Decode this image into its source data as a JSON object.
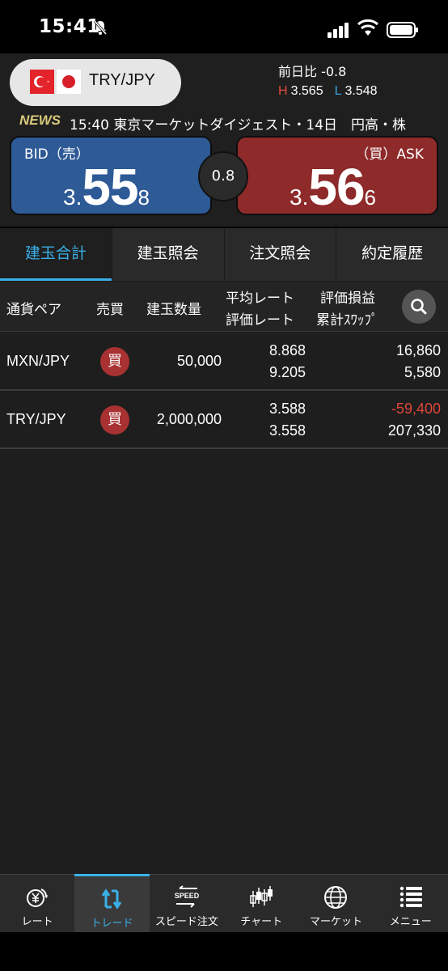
{
  "status": {
    "time": "15:41"
  },
  "header": {
    "pair": "TRY/JPY",
    "prev_diff": "前日比 -0.8",
    "high_label": "H",
    "high": "3.565",
    "low_label": "L",
    "low": "3.548",
    "news_badge": "NEWS",
    "news_text": "15:40 東京マーケットダイジェスト・14日　円高・株",
    "bid_label": "BID（売）",
    "bid": {
      "p1": "3.",
      "p2": "55",
      "p3": "8"
    },
    "ask_label": "（買）ASK",
    "ask": {
      "p1": "3.",
      "p2": "56",
      "p3": "6"
    },
    "spread": "0.8"
  },
  "tabs": [
    {
      "label": "建玉合計",
      "active": true
    },
    {
      "label": "建玉照会",
      "active": false
    },
    {
      "label": "注文照会",
      "active": false
    },
    {
      "label": "約定履歴",
      "active": false
    }
  ],
  "columns": {
    "pair": "通貨ペア",
    "side": "売買",
    "qty": "建玉数量",
    "avg_rate": "平均レート",
    "eval_rate": "評価レート",
    "pl": "評価損益",
    "swap": "累計ｽﾜｯﾌﾟ"
  },
  "positions": [
    {
      "pair": "MXN/JPY",
      "side": "買",
      "qty": "50,000",
      "avg_rate": "8.868",
      "eval_rate": "9.205",
      "pl": "16,860",
      "swap": "5,580"
    },
    {
      "pair": "TRY/JPY",
      "side": "買",
      "qty": "2,000,000",
      "avg_rate": "3.588",
      "eval_rate": "3.558",
      "pl": "-59,400",
      "swap": "207,330"
    }
  ],
  "nav": [
    {
      "label": "レート",
      "icon": "yen-rate-icon"
    },
    {
      "label": "トレード",
      "icon": "trade-icon",
      "active": true
    },
    {
      "label": "スピード注文",
      "icon": "speed-order-icon"
    },
    {
      "label": "チャート",
      "icon": "candlestick-chart-icon"
    },
    {
      "label": "マーケット",
      "icon": "globe-icon"
    },
    {
      "label": "メニュー",
      "icon": "menu-list-icon"
    }
  ],
  "colors": {
    "bid": "#2e5a96",
    "ask": "#8e2a2a",
    "accent": "#3ab0e8",
    "negative": "#e0463a"
  }
}
